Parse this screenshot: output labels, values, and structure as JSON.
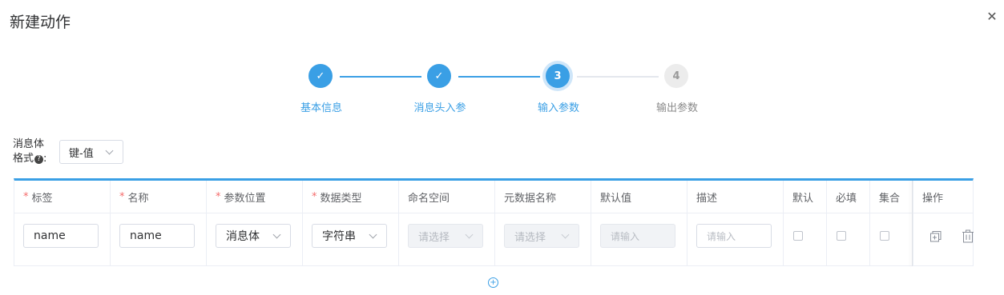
{
  "dialog": {
    "title": "新建动作",
    "close_icon": "close-icon"
  },
  "steps": [
    {
      "num": "1",
      "label": "基本信息",
      "status": "done"
    },
    {
      "num": "2",
      "label": "消息头入参",
      "status": "done"
    },
    {
      "num": "3",
      "label": "输入参数",
      "status": "active"
    },
    {
      "num": "4",
      "label": "输出参数",
      "status": "todo"
    }
  ],
  "format": {
    "label_line1": "消息体",
    "label_line2": "格式",
    "help": "?",
    "colon": ":",
    "value": "键-值"
  },
  "table": {
    "headers": [
      {
        "label": "标签",
        "required": true
      },
      {
        "label": "名称",
        "required": true
      },
      {
        "label": "参数位置",
        "required": true
      },
      {
        "label": "数据类型",
        "required": true
      },
      {
        "label": "命名空间",
        "required": false
      },
      {
        "label": "元数据名称",
        "required": false
      },
      {
        "label": "默认值",
        "required": false
      },
      {
        "label": "描述",
        "required": false
      },
      {
        "label": "默认",
        "required": false
      },
      {
        "label": "必填",
        "required": false
      },
      {
        "label": "集合",
        "required": false
      },
      {
        "label": "操作",
        "required": false
      }
    ],
    "required_mark": "*",
    "row": {
      "tag": "name",
      "name": "name",
      "position": "消息体",
      "data_type": "字符串",
      "namespace_placeholder": "请选择",
      "metadata_placeholder": "请选择",
      "default_placeholder": "请输入",
      "description_placeholder": "请输入",
      "is_default": false,
      "is_required": false,
      "is_collection": false
    }
  },
  "add_row": {
    "icon": "add-circle-icon",
    "glyph": "+"
  },
  "colors": {
    "accent": "#3a9fe5",
    "required": "#f56c6c"
  }
}
